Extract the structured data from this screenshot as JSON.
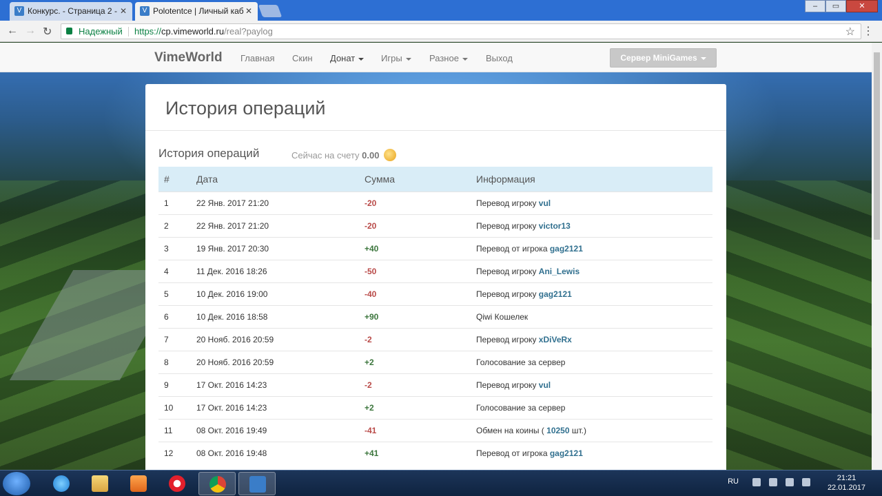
{
  "browser": {
    "tabs": [
      {
        "title": "Конкурс. - Страница 2 -",
        "active": false
      },
      {
        "title": "Polotentce | Личный каб",
        "active": true
      }
    ],
    "secure_label": "Надежный",
    "url_proto": "https://",
    "url_host": "cp.vimeworld.ru",
    "url_path": "/real?paylog"
  },
  "navbar": {
    "brand": "VimeWorld",
    "items": [
      {
        "label": "Главная",
        "dropdown": false
      },
      {
        "label": "Скин",
        "dropdown": false
      },
      {
        "label": "Донат",
        "dropdown": true
      },
      {
        "label": "Игры",
        "dropdown": true
      },
      {
        "label": "Разное",
        "dropdown": true
      },
      {
        "label": "Выход",
        "dropdown": false
      }
    ],
    "server_button": "Сервер MiniGames"
  },
  "page": {
    "title": "История операций",
    "subtitle": "История операций",
    "balance_label": "Сейчас на счету",
    "balance_value": "0.00"
  },
  "table": {
    "headers": [
      "#",
      "Дата",
      "Сумма",
      "Информация"
    ],
    "rows": [
      {
        "n": "1",
        "date": "22 Янв. 2017 21:20",
        "amount": "-20",
        "info": "Перевод игроку",
        "player": "vul",
        "suffix": ""
      },
      {
        "n": "2",
        "date": "22 Янв. 2017 21:20",
        "amount": "-20",
        "info": "Перевод игроку",
        "player": "victor13",
        "suffix": ""
      },
      {
        "n": "3",
        "date": "19 Янв. 2017 20:30",
        "amount": "+40",
        "info": "Перевод от игрока",
        "player": "gag2121",
        "suffix": ""
      },
      {
        "n": "4",
        "date": "11 Дек. 2016 18:26",
        "amount": "-50",
        "info": "Перевод игроку",
        "player": "Ani_Lewis",
        "suffix": ""
      },
      {
        "n": "5",
        "date": "10 Дек. 2016 19:00",
        "amount": "-40",
        "info": "Перевод игроку",
        "player": "gag2121",
        "suffix": ""
      },
      {
        "n": "6",
        "date": "10 Дек. 2016 18:58",
        "amount": "+90",
        "info": "Qiwi Кошелек",
        "player": "",
        "suffix": ""
      },
      {
        "n": "7",
        "date": "20 Нояб. 2016 20:59",
        "amount": "-2",
        "info": "Перевод игроку",
        "player": "xDiVeRx",
        "suffix": ""
      },
      {
        "n": "8",
        "date": "20 Нояб. 2016 20:59",
        "amount": "+2",
        "info": "Голосование за сервер",
        "player": "",
        "suffix": ""
      },
      {
        "n": "9",
        "date": "17 Окт. 2016 14:23",
        "amount": "-2",
        "info": "Перевод игроку",
        "player": "vul",
        "suffix": ""
      },
      {
        "n": "10",
        "date": "17 Окт. 2016 14:23",
        "amount": "+2",
        "info": "Голосование за сервер",
        "player": "",
        "suffix": ""
      },
      {
        "n": "11",
        "date": "08 Окт. 2016 19:49",
        "amount": "-41",
        "info": "Обмен на коины (",
        "player": "10250",
        "suffix": " шт.)"
      },
      {
        "n": "12",
        "date": "08 Окт. 2016 19:48",
        "amount": "+41",
        "info": "Перевод от игрока",
        "player": "gag2121",
        "suffix": ""
      }
    ]
  },
  "taskbar": {
    "lang": "RU",
    "time": "21:21",
    "date": "22.01.2017"
  },
  "colors": {
    "negative": "#b94a48",
    "positive": "#3c763d",
    "player_link": "#31708f",
    "table_header_bg": "#d9edf7"
  },
  "icons": [
    "back-icon",
    "forward-icon",
    "reload-icon",
    "lock-icon",
    "star-icon",
    "menu-icon",
    "coin-icon",
    "windows-start-icon",
    "ie-icon",
    "explorer-icon",
    "media-player-icon",
    "opera-icon",
    "chrome-icon",
    "vimeworld-icon"
  ]
}
